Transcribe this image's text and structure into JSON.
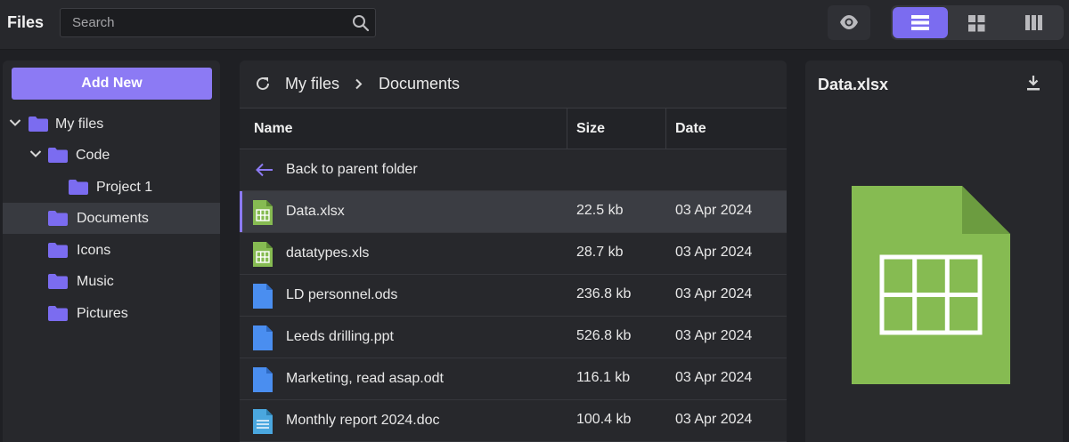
{
  "app": {
    "title": "Files"
  },
  "search": {
    "placeholder": "Search",
    "value": ""
  },
  "toolbar": {
    "preview_icon": "eye-icon",
    "views": [
      {
        "icon": "list-view-icon",
        "active": true
      },
      {
        "icon": "grid-view-icon",
        "active": false
      },
      {
        "icon": "columns-view-icon",
        "active": false
      }
    ],
    "accent_color": "#7b6cf0"
  },
  "sidebar": {
    "add_new_label": "Add New",
    "tree": [
      {
        "label": "My files",
        "expanded": true,
        "level": 0
      },
      {
        "label": "Code",
        "expanded": true,
        "level": 1
      },
      {
        "label": "Project 1",
        "level": 2
      },
      {
        "label": "Documents",
        "level": 1,
        "selected": true
      },
      {
        "label": "Icons",
        "level": 1
      },
      {
        "label": "Music",
        "level": 1
      },
      {
        "label": "Pictures",
        "level": 1
      }
    ]
  },
  "breadcrumb": {
    "items": [
      "My files",
      "Documents"
    ]
  },
  "table": {
    "columns": {
      "name": "Name",
      "size": "Size",
      "date": "Date"
    },
    "back_label": "Back to parent folder",
    "rows": [
      {
        "name": "Data.xlsx",
        "size": "22.5 kb",
        "date": "03 Apr 2024",
        "type": "spreadsheet",
        "selected": true
      },
      {
        "name": "datatypes.xls",
        "size": "28.7 kb",
        "date": "03 Apr 2024",
        "type": "spreadsheet"
      },
      {
        "name": "LD personnel.ods",
        "size": "236.8 kb",
        "date": "03 Apr 2024",
        "type": "file"
      },
      {
        "name": "Leeds drilling.ppt",
        "size": "526.8 kb",
        "date": "03 Apr 2024",
        "type": "file"
      },
      {
        "name": "Marketing, read asap.odt",
        "size": "116.1 kb",
        "date": "03 Apr 2024",
        "type": "file"
      },
      {
        "name": "Monthly report 2024.doc",
        "size": "100.4 kb",
        "date": "03 Apr 2024",
        "type": "document"
      }
    ]
  },
  "preview": {
    "title": "Data.xlsx",
    "download_icon": "download-icon"
  },
  "colors": {
    "folder": "#7b6cf0",
    "spreadsheet": "#86bb52",
    "file": "#4a8ef0",
    "document": "#4aa7df"
  }
}
